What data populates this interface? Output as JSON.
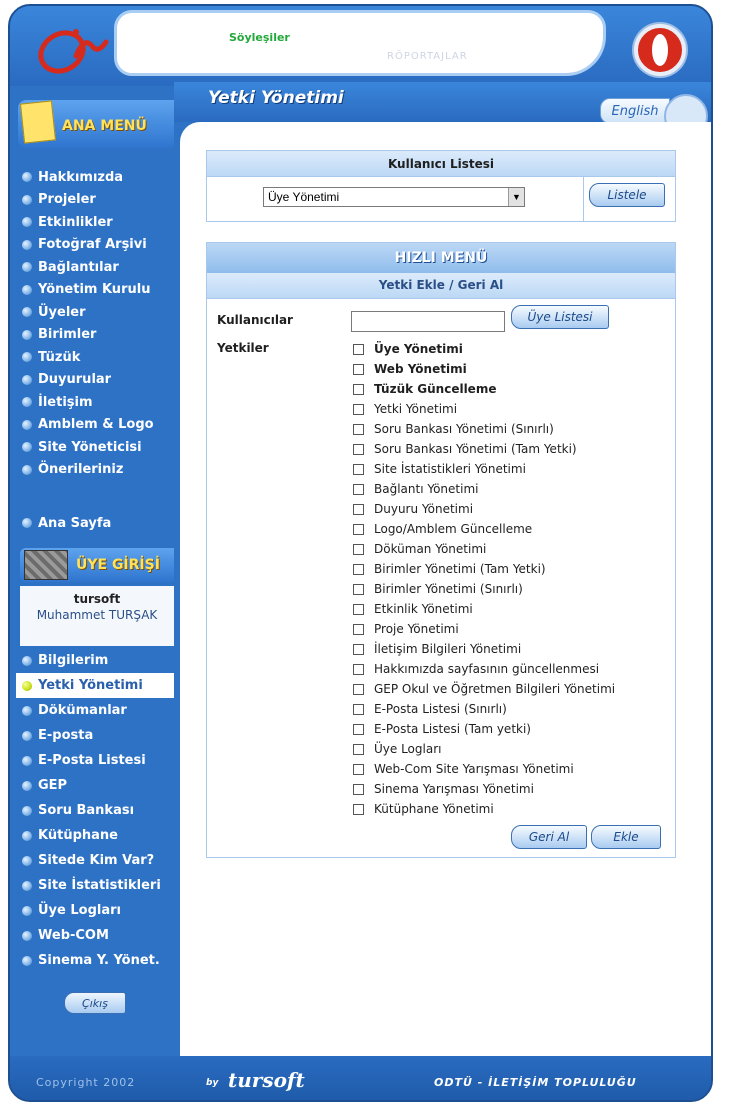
{
  "header": {
    "ticker_primary": "Söyleşiler",
    "ticker_secondary": "RÖPORTAJLAR"
  },
  "page": {
    "title": "Yetki Yönetimi",
    "language_button": "English"
  },
  "sidebar": {
    "main_menu_label": "ANA MENÜ",
    "items": [
      "Hakkımızda",
      "Projeler",
      "Etkinlikler",
      "Fotoğraf Arşivi",
      "Bağlantılar",
      "Yönetim Kurulu",
      "Üyeler",
      "Birimler",
      "Tüzük",
      "Duyurular",
      "İletişim",
      "Amblem & Logo",
      "Site Yöneticisi",
      "Önerileriniz"
    ],
    "home": "Ana Sayfa",
    "member_login_label": "ÜYE GİRİŞİ",
    "user": {
      "username": "tursoft",
      "fullname": "Muhammet TURŞAK"
    },
    "member_items": [
      "Bilgilerim",
      "Yetki Yönetimi",
      "Dökümanlar",
      "E-posta",
      "E-Posta Listesi",
      "GEP",
      "Soru Bankası",
      "Kütüphane",
      "Sitede Kim Var?",
      "Site İstatistikleri",
      "Üye Logları",
      "Web-COM",
      "Sinema Y. Yönet."
    ],
    "active_member_item": "Yetki Yönetimi",
    "logout_button": "Çıkış"
  },
  "user_list_panel": {
    "title": "Kullanıcı Listesi",
    "selected": "Üye Yönetimi",
    "list_button": "Listele"
  },
  "quick_menu": {
    "title": "HIZLI MENÜ",
    "subtitle": "Yetki Ekle / Geri Al",
    "users_label": "Kullanıcılar",
    "users_value": "",
    "member_list_button": "Üye Listesi",
    "permissions_label": "Yetkiler",
    "permissions": [
      {
        "label": "Üye Yönetimi",
        "bold": true
      },
      {
        "label": "Web Yönetimi",
        "bold": true
      },
      {
        "label": "Tüzük Güncelleme",
        "bold": true
      },
      {
        "label": "Yetki Yönetimi",
        "bold": false
      },
      {
        "label": "Soru Bankası Yönetimi (Sınırlı)",
        "bold": false
      },
      {
        "label": "Soru Bankası Yönetimi (Tam Yetki)",
        "bold": false
      },
      {
        "label": "Site İstatistikleri Yönetimi",
        "bold": false
      },
      {
        "label": "Bağlantı Yönetimi",
        "bold": false
      },
      {
        "label": "Duyuru Yönetimi",
        "bold": false
      },
      {
        "label": "Logo/Amblem Güncelleme",
        "bold": false
      },
      {
        "label": "Döküman Yönetimi",
        "bold": false
      },
      {
        "label": "Birimler Yönetimi (Tam Yetki)",
        "bold": false
      },
      {
        "label": "Birimler Yönetimi (Sınırlı)",
        "bold": false
      },
      {
        "label": "Etkinlik Yönetimi",
        "bold": false
      },
      {
        "label": "Proje Yönetimi",
        "bold": false
      },
      {
        "label": "İletişim Bilgileri Yönetimi",
        "bold": false
      },
      {
        "label": "Hakkımızda sayfasının güncellenmesi",
        "bold": false
      },
      {
        "label": "GEP Okul ve Öğretmen Bilgileri Yönetimi",
        "bold": false
      },
      {
        "label": "E-Posta Listesi (Sınırlı)",
        "bold": false
      },
      {
        "label": "E-Posta Listesi (Tam yetki)",
        "bold": false
      },
      {
        "label": "Üye Logları",
        "bold": false
      },
      {
        "label": "Web-Com Site Yarışması Yönetimi",
        "bold": false
      },
      {
        "label": "Sinema Yarışması Yönetimi",
        "bold": false
      },
      {
        "label": "Kütüphane Yönetimi",
        "bold": false
      }
    ],
    "revoke_button": "Geri Al",
    "add_button": "Ekle"
  },
  "footer": {
    "copyright": "Copyright 2002",
    "by": "by",
    "brand": "tursoft",
    "club": "ODTÜ - İLETİŞİM TOPLULUĞU"
  },
  "colors": {
    "frame_blue": "#2e72c6",
    "menu_yellow": "#ffe15a",
    "active_dot": "#c8df12"
  }
}
